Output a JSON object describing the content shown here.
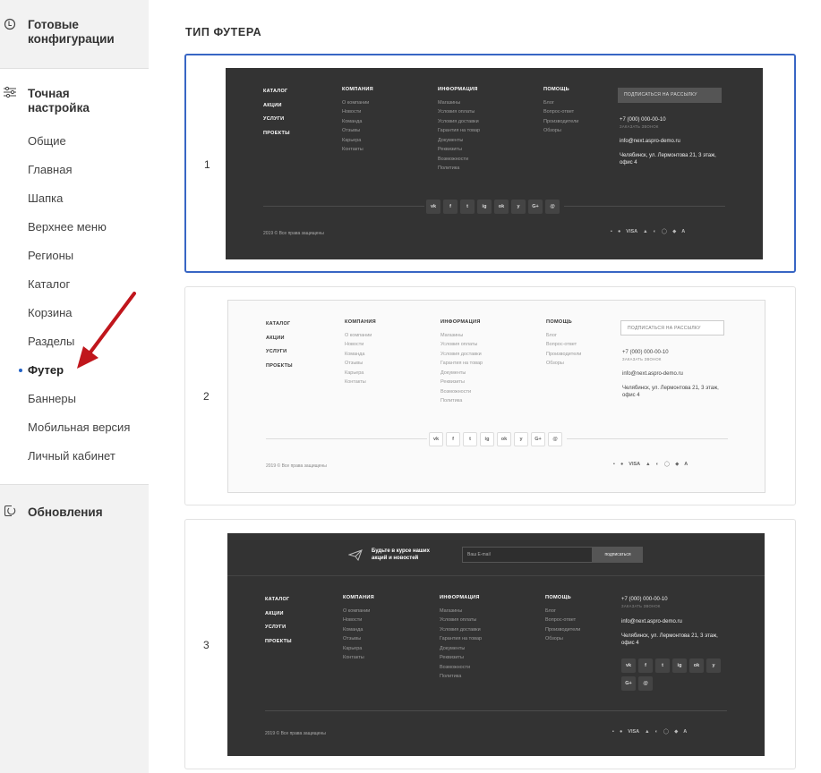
{
  "sidebar": {
    "ready_configs": "Готовые конфигурации",
    "fine_tuning": "Точная настройка",
    "items": [
      "Общие",
      "Главная",
      "Шапка",
      "Верхнее меню",
      "Регионы",
      "Каталог",
      "Корзина",
      "Разделы",
      "Футер",
      "Баннеры",
      "Мобильная версия",
      "Личный кабинет"
    ],
    "updates": "Обновления",
    "active_index": 8
  },
  "main": {
    "title": "ТИП ФУТЕРА"
  },
  "footer_preview": {
    "main_links": [
      "КАТАЛОГ",
      "АКЦИИ",
      "УСЛУГИ",
      "ПРОЕКТЫ"
    ],
    "company": {
      "title": "КОМПАНИЯ",
      "links": [
        "О компании",
        "Новости",
        "Команда",
        "Отзывы",
        "Карьера",
        "Контакты"
      ]
    },
    "info": {
      "title": "ИНФОРМАЦИЯ",
      "links": [
        "Магазины",
        "Условия оплаты",
        "Условия доставки",
        "Гарантия на товар",
        "Документы",
        "Реквизиты",
        "Возможности",
        "Политика"
      ]
    },
    "help": {
      "title": "ПОМОЩЬ",
      "links": [
        "Блог",
        "Вопрос-ответ",
        "Производители",
        "Обзоры"
      ]
    },
    "subscribe": "ПОДПИСАТЬСЯ НА РАССЫЛКУ",
    "phone": "+7 (000) 000-00-10",
    "callback": "ЗАКАЗАТЬ ЗВОНОК",
    "email": "info@next.aspro-demo.ru",
    "address": "Челябинск, ул. Лермонтова 21, 3 этаж, офис 4",
    "social": [
      "vk",
      "f",
      "t",
      "ig",
      "ok",
      "y",
      "G+",
      "@"
    ],
    "copyright": "2019 © Все права защищены",
    "payments": [
      "▪",
      "●",
      "VISA",
      "▲",
      "◐",
      "◯",
      "◆",
      "A"
    ],
    "newsletter_text": "Будьте в курсе наших акций и новостей",
    "email_placeholder": "Ваш E-mail",
    "subscribe_button": "подписаться"
  },
  "cards": [
    {
      "number": "1",
      "theme": "dark",
      "selected": true
    },
    {
      "number": "2",
      "theme": "light",
      "selected": false
    },
    {
      "number": "3",
      "theme": "dark",
      "selected": false
    }
  ],
  "colors": {
    "accent": "#3866c4",
    "arrow": "#c0161c",
    "dark_bg": "#333333"
  }
}
